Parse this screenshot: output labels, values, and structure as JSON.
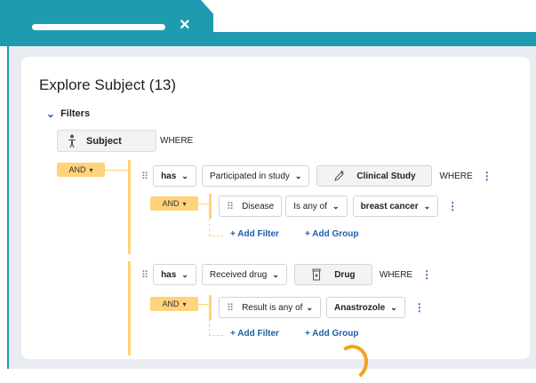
{
  "tab": {
    "close_icon": "×"
  },
  "page": {
    "title": "Explore Subject (13)"
  },
  "filters": {
    "label": "Filters"
  },
  "subject": {
    "label": "Subject",
    "where": "WHERE",
    "icon": "person-icon"
  },
  "root_and": {
    "label": "AND",
    "caret": "⌄"
  },
  "group1": {
    "has": "has",
    "predicate": "Participated in study",
    "entity": "Clinical Study",
    "where": "WHERE",
    "and_label": "AND",
    "filter": {
      "field": "Disease",
      "operator": "Is any of",
      "value": "breast cancer"
    },
    "add_filter": "+ Add Filter",
    "add_group": "+ Add Group"
  },
  "group2": {
    "has": "has",
    "predicate": "Received drug",
    "entity": "Drug",
    "where": "WHERE",
    "and_label": "AND",
    "filter": {
      "field_operator": "Result is any of",
      "value": "Anastrozole"
    },
    "add_filter": "+ Add Filter",
    "add_group": "+ Add Group"
  },
  "colors": {
    "teal": "#1f9bb0",
    "and_yellow": "#ffd37a",
    "link_blue": "#1f5fa8",
    "cursor_orange": "#f3a21b"
  }
}
